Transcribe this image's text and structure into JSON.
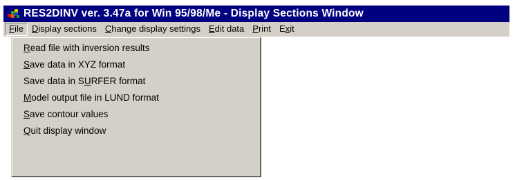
{
  "window": {
    "title": "RES2DINV ver. 3.47a for Win 95/98/Me - Display Sections Window"
  },
  "menubar": {
    "items": [
      {
        "pre": "",
        "accel": "F",
        "post": "ile",
        "active": true
      },
      {
        "pre": "",
        "accel": "D",
        "post": "isplay sections"
      },
      {
        "pre": "",
        "accel": "C",
        "post": "hange display settings"
      },
      {
        "pre": "",
        "accel": "E",
        "post": "dit data"
      },
      {
        "pre": "",
        "accel": "P",
        "post": "rint"
      },
      {
        "pre": "E",
        "accel": "x",
        "post": "it"
      }
    ]
  },
  "file_menu": {
    "items": [
      {
        "pre": "",
        "accel": "R",
        "post": "ead file with inversion results"
      },
      {
        "pre": "",
        "accel": "S",
        "post": "ave data in XYZ format"
      },
      {
        "pre": "Save data in S",
        "accel": "U",
        "post": "RFER format"
      },
      {
        "pre": "",
        "accel": "M",
        "post": "odel output file in LUND format"
      },
      {
        "pre": "",
        "accel": "S",
        "post": "ave contour values"
      },
      {
        "pre": "",
        "accel": "Q",
        "post": "uit display window"
      }
    ]
  },
  "colors": {
    "titlebar": "#000080",
    "menu_face": "#d4d0c8"
  },
  "icons": {
    "app": "res2dinv-app-icon"
  }
}
